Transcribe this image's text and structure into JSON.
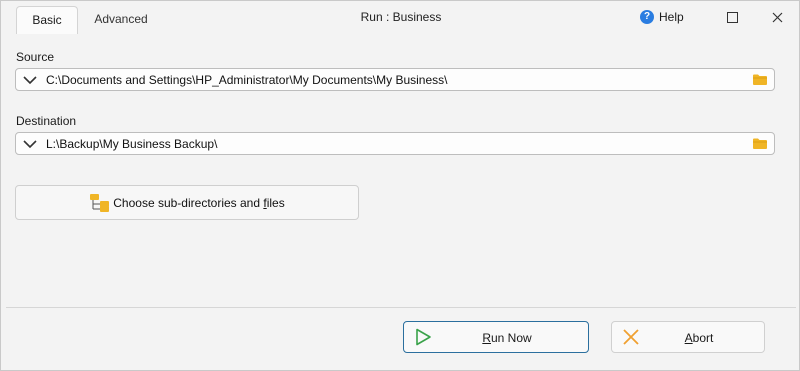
{
  "tabs": [
    {
      "label": "Basic",
      "active": true
    },
    {
      "label": "Advanced",
      "active": false
    }
  ],
  "window": {
    "title": "Run : Business",
    "help_label": "Help"
  },
  "source": {
    "label": "Source",
    "value": "C:\\Documents and Settings\\HP_Administrator\\My Documents\\My Business\\"
  },
  "destination": {
    "label": "Destination",
    "value": "L:\\Backup\\My Business Backup\\"
  },
  "choose": {
    "label_pre": "Choose sub-directories and ",
    "label_u": "f",
    "label_post": "iles"
  },
  "run_now": {
    "label_u": "R",
    "label_post": "un Now"
  },
  "abort": {
    "label_u": "A",
    "label_post": "bort"
  },
  "colors": {
    "accent": "#2b6f9e",
    "folder": "#f0b526",
    "run_icon": "#3aa24a",
    "abort_icon": "#f0a030",
    "help": "#2a7de1"
  }
}
